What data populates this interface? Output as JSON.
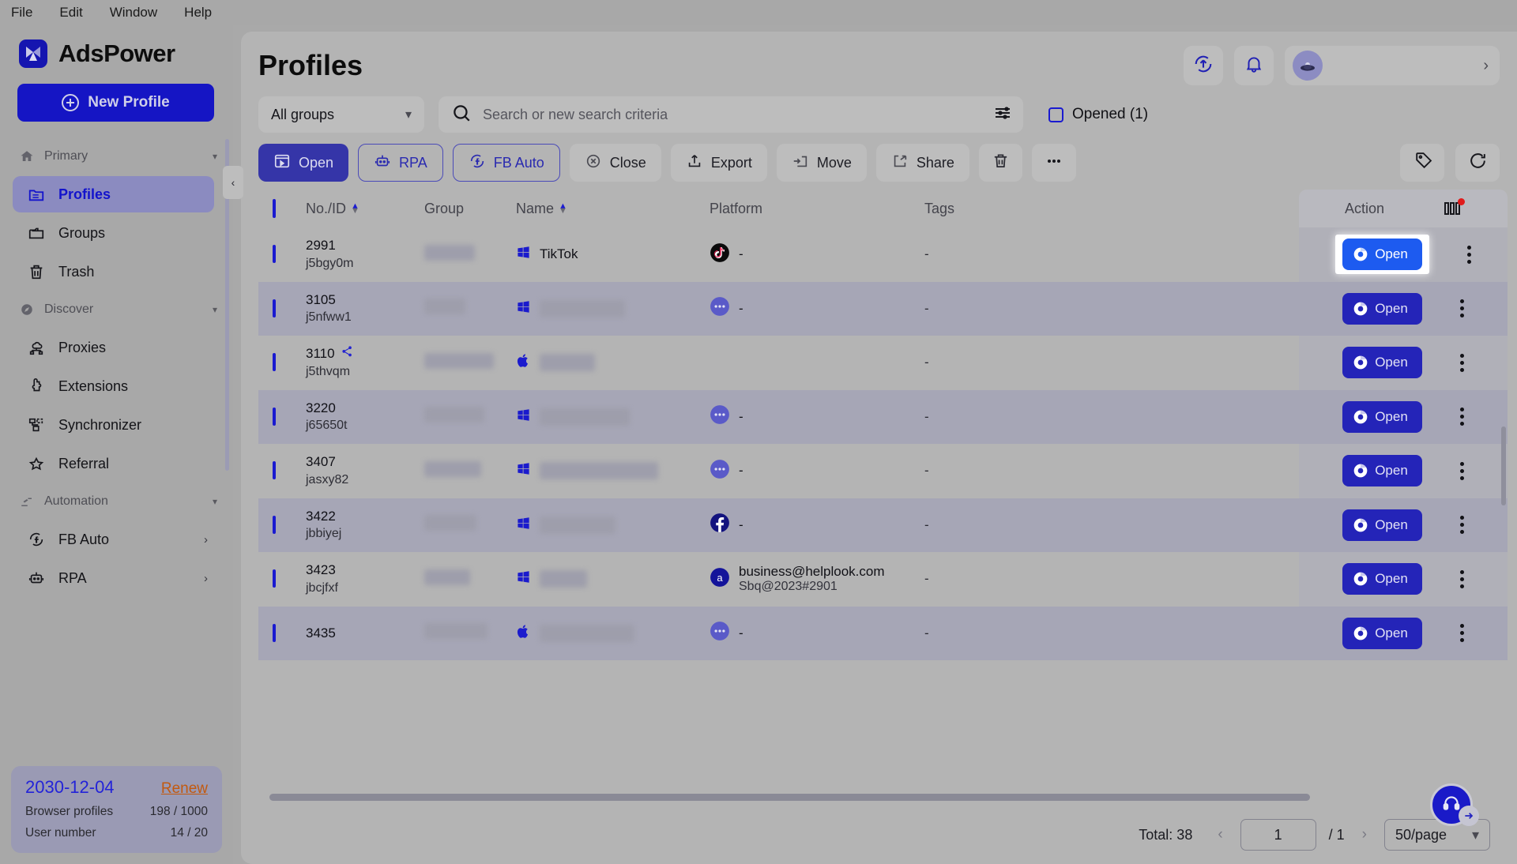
{
  "menubar": [
    "File",
    "Edit",
    "Window",
    "Help"
  ],
  "brand": {
    "name": "AdsPower"
  },
  "sidebar": {
    "new_profile_label": "New Profile",
    "sections": [
      {
        "label": "Primary",
        "icon": "home-icon",
        "items": [
          {
            "label": "Profiles",
            "icon": "profiles-icon",
            "active": true
          },
          {
            "label": "Groups",
            "icon": "folder-icon",
            "active": false
          },
          {
            "label": "Trash",
            "icon": "trash-icon",
            "active": false
          }
        ]
      },
      {
        "label": "Discover",
        "icon": "compass-icon",
        "items": [
          {
            "label": "Proxies",
            "icon": "proxy-icon",
            "active": false
          },
          {
            "label": "Extensions",
            "icon": "puzzle-icon",
            "active": false
          },
          {
            "label": "Synchronizer",
            "icon": "sync-icon",
            "active": false
          },
          {
            "label": "Referral",
            "icon": "star-icon",
            "active": false
          }
        ]
      },
      {
        "label": "Automation",
        "icon": "robot-arm-icon",
        "items": [
          {
            "label": "FB Auto",
            "icon": "fb-auto-icon",
            "active": false,
            "expand": true
          },
          {
            "label": "RPA",
            "icon": "rpa-robot-icon",
            "active": false,
            "expand": true
          }
        ]
      }
    ],
    "license": {
      "date": "2030-12-04",
      "renew_label": "Renew",
      "rows": [
        {
          "label": "Browser profiles",
          "value": "198 / 1000"
        },
        {
          "label": "User number",
          "value": "14 / 20"
        }
      ]
    }
  },
  "header": {
    "title": "Profiles",
    "sync_icon": "sync-upload-icon",
    "bell_icon": "bell-icon",
    "account_chevron": "chevron-right-icon"
  },
  "filters": {
    "group_value": "All groups",
    "search_placeholder": "Search or new search criteria",
    "search_value": "",
    "settings_icon": "sliders-icon",
    "opened_label": "Opened (1)"
  },
  "toolbar": {
    "buttons": [
      {
        "label": "Open",
        "icon": "window-open-icon",
        "style": "primary"
      },
      {
        "label": "RPA",
        "icon": "rpa-robot-icon",
        "style": "outline"
      },
      {
        "label": "FB Auto",
        "icon": "fb-auto-icon",
        "style": "outline"
      },
      {
        "label": "Close",
        "icon": "close-circle-icon",
        "style": "plain"
      },
      {
        "label": "Export",
        "icon": "export-icon",
        "style": "plain"
      },
      {
        "label": "Move",
        "icon": "move-folder-icon",
        "style": "plain"
      },
      {
        "label": "Share",
        "icon": "share-icon",
        "style": "plain"
      },
      {
        "label": "",
        "icon": "trash-icon",
        "style": "plain"
      },
      {
        "label": "",
        "icon": "more-dots-icon",
        "style": "plain"
      }
    ],
    "right_icons": [
      {
        "icon": "tag-icon"
      },
      {
        "icon": "refresh-icon"
      }
    ]
  },
  "table": {
    "columns": [
      {
        "label": "No./ID",
        "sortable": true
      },
      {
        "label": "Group",
        "sortable": false
      },
      {
        "label": "Name",
        "sortable": true
      },
      {
        "label": "Platform",
        "sortable": false
      },
      {
        "label": "Tags",
        "sortable": false
      },
      {
        "label": "Action",
        "sortable": false
      }
    ],
    "column_settings_icon": "column-settings-icon",
    "open_label": "Open",
    "rows": [
      {
        "no": "2991",
        "id": "j5bgy0m",
        "os": "windows",
        "name": "TikTok",
        "name_blurred": false,
        "platform_icon": "tiktok-icon",
        "platform_text": "-",
        "platform_sub": "",
        "tags": "-",
        "highlight_open": true,
        "share_badge": false
      },
      {
        "no": "3105",
        "id": "j5nfww1",
        "os": "windows",
        "name": "",
        "name_blurred": true,
        "platform_icon": "dots-circle-icon",
        "platform_text": "-",
        "platform_sub": "",
        "tags": "-",
        "highlight_open": false,
        "share_badge": false
      },
      {
        "no": "3110",
        "id": "j5thvqm",
        "os": "apple",
        "name": "",
        "name_blurred": true,
        "platform_icon": "",
        "platform_text": "",
        "platform_sub": "",
        "tags": "-",
        "highlight_open": false,
        "share_badge": true
      },
      {
        "no": "3220",
        "id": "j65650t",
        "os": "windows",
        "name": "",
        "name_blurred": true,
        "platform_icon": "dots-circle-icon",
        "platform_text": "-",
        "platform_sub": "",
        "tags": "-",
        "highlight_open": false,
        "share_badge": false
      },
      {
        "no": "3407",
        "id": "jasxy82",
        "os": "windows",
        "name": "",
        "name_blurred": true,
        "platform_icon": "dots-circle-icon",
        "platform_text": "-",
        "platform_sub": "",
        "tags": "-",
        "highlight_open": false,
        "share_badge": false
      },
      {
        "no": "3422",
        "id": "jbbiyej",
        "os": "windows",
        "name": "",
        "name_blurred": true,
        "platform_icon": "facebook-icon",
        "platform_text": "-",
        "platform_sub": "",
        "tags": "-",
        "highlight_open": false,
        "share_badge": false
      },
      {
        "no": "3423",
        "id": "jbcjfxf",
        "os": "windows",
        "name": "",
        "name_blurred": true,
        "platform_icon": "amazon-icon",
        "platform_text": "business@helplook.com",
        "platform_sub": "Sbq@2023#2901",
        "tags": "-",
        "highlight_open": false,
        "share_badge": false
      },
      {
        "no": "3435",
        "id": "",
        "os": "apple",
        "name": "",
        "name_blurred": true,
        "platform_icon": "dots-circle-icon",
        "platform_text": "-",
        "platform_sub": "",
        "tags": "-",
        "highlight_open": false,
        "share_badge": false
      }
    ]
  },
  "footer": {
    "total_label": "Total: 38",
    "page_value": "1",
    "page_of": "/ 1",
    "page_size": "50/page",
    "prev_icon": "chevron-left-icon",
    "next_icon": "chevron-right-icon"
  },
  "support": {
    "icon": "headset-icon"
  }
}
